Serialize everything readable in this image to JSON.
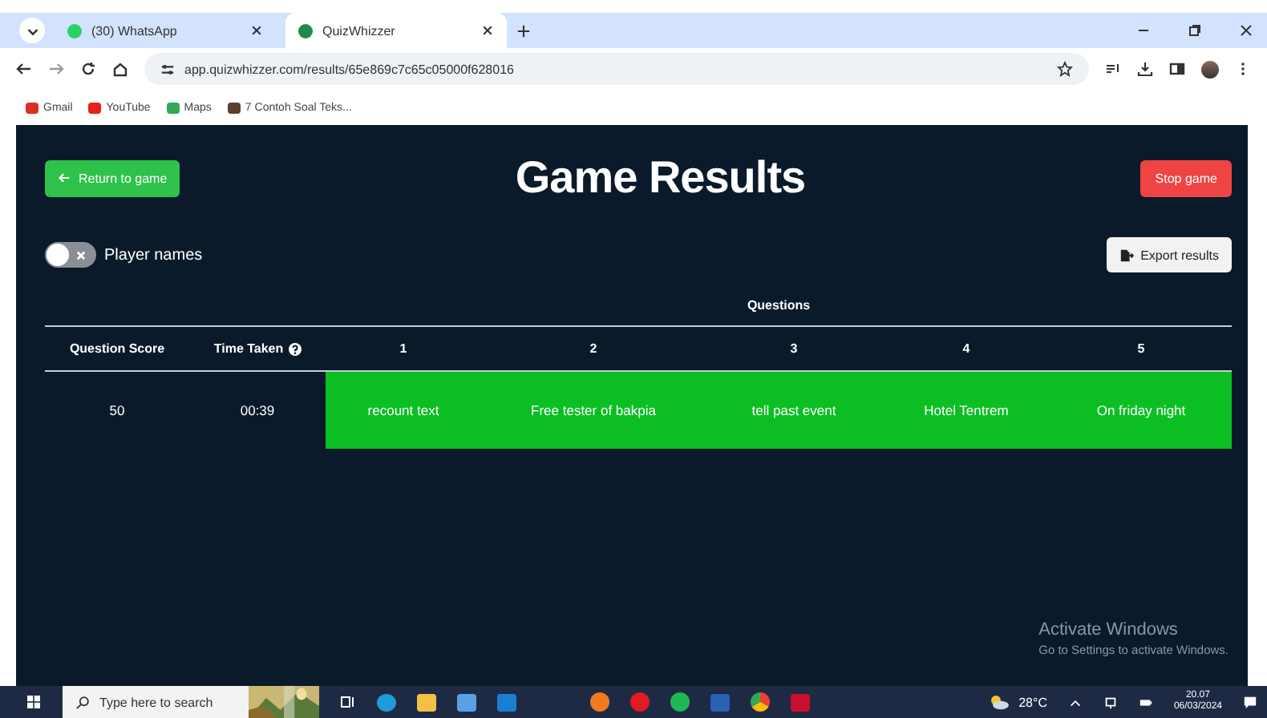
{
  "browser": {
    "tabs": [
      {
        "title": "(30) WhatsApp",
        "selected": false
      },
      {
        "title": "QuizWhizzer",
        "selected": true
      }
    ],
    "url": "app.quizwhizzer.com/results/65e869c7c65c05000f628016",
    "bookmarks": [
      "Gmail",
      "YouTube",
      "Maps",
      "7 Contoh Soal Teks..."
    ]
  },
  "page": {
    "return_button": "Return to game",
    "title": "Game Results",
    "stop_button": "Stop game",
    "player_names_toggle": {
      "label": "Player names",
      "on": false
    },
    "export_button": "Export results",
    "table": {
      "group_heading": "Questions",
      "columns": [
        "Question Score",
        "Time Taken",
        "1",
        "2",
        "3",
        "4",
        "5"
      ],
      "rows": [
        {
          "score": "50",
          "time": "00:39",
          "answers": [
            {
              "text": "recount text",
              "correct": true
            },
            {
              "text": "Free tester of bakpia",
              "correct": true
            },
            {
              "text": "tell past event",
              "correct": true
            },
            {
              "text": "Hotel Tentrem",
              "correct": true
            },
            {
              "text": "On friday night",
              "correct": true
            }
          ]
        }
      ]
    }
  },
  "activation_notice": {
    "title": "Activate Windows",
    "text": "Go to Settings to activate Windows."
  },
  "taskbar": {
    "search_placeholder": "Type here to search",
    "temperature": "28°C",
    "time": "20.07",
    "date": "06/03/2024"
  }
}
